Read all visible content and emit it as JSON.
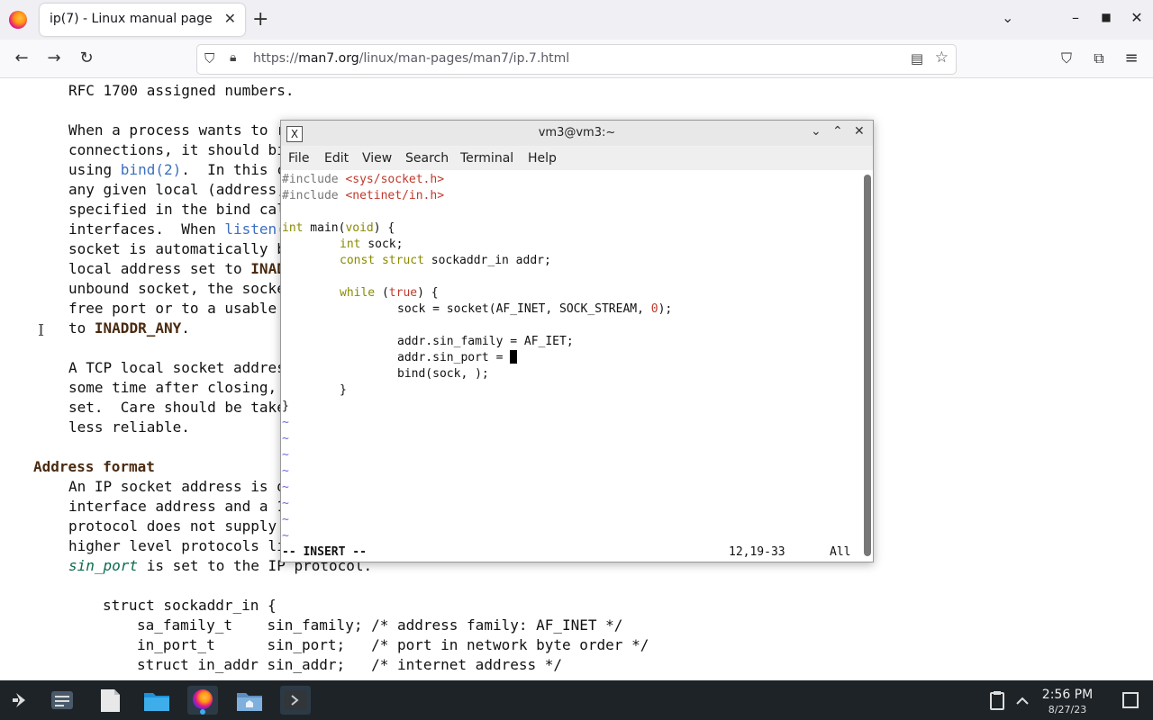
{
  "browser": {
    "tab_title": "ip(7) - Linux manual page",
    "url_prefix": "https://",
    "url_domain": "man7.org",
    "url_path": "/linux/man-pages/man7/ip.7.html"
  },
  "page": {
    "lines": [
      "RFC 1700 assigned numbers.",
      "When a process wants to r",
      "connections, it should bi",
      "using ",
      "bind(2)",
      ".  In this c",
      "any given local (address,",
      "specified in the bind cal",
      "interfaces.  When ",
      "listen(",
      "socket is automatically b",
      "local address set to ",
      "INAD",
      "unbound socket, the socke",
      "free port or to a usable",
      "to ",
      "INADDR_ANY",
      ".",
      "A TCP local socket addres",
      "some time after closing,",
      "set.  Care should be take",
      "less reliable.",
      "Address format",
      "An IP socket address is d",
      "interface address and a 1",
      "protocol does not supply",
      "higher level protocols li",
      "sin_port",
      " is set to the IP protocol.",
      "struct sockaddr_in {",
      "sa_family_t    sin_family; /* address family: AF_INET */",
      "in_port_t      sin_port;   /* port in network byte order */",
      "struct in_addr sin_addr;   /* internet address */"
    ]
  },
  "terminal": {
    "title": "vm3@vm3:~",
    "menu": [
      "File",
      "Edit",
      "View",
      "Search",
      "Terminal",
      "Help"
    ],
    "code": {
      "inc1_kw": "#include ",
      "inc1_file": "<sys/socket.h>",
      "inc2_kw": "#include ",
      "inc2_file": "<netinet/in.h>",
      "main_type": "int",
      "main_rest": " main(",
      "main_void": "void",
      "main_end": ") {",
      "l_int": "int",
      "l_sock": " sock;",
      "l_const": "const struct",
      "l_addr": " sockaddr_in addr;",
      "l_while": "while",
      "l_true": "true",
      "l_socket": "sock = socket(AF_INET, SOCK_STREAM, ",
      "l_zero": "0",
      "l_socket_end": ");",
      "l_family": "addr.sin_family = AF_IET;",
      "l_port": "addr.sin_port = ",
      "l_bind": "bind(sock, );",
      "l_close_inner": "}",
      "l_close_outer": "}",
      "tilde": "~"
    },
    "status_mode": "-- INSERT --",
    "status_pos": "12,19-33",
    "status_scroll": "All"
  },
  "taskbar": {
    "time": "2:56 PM",
    "date": "8/27/23"
  }
}
